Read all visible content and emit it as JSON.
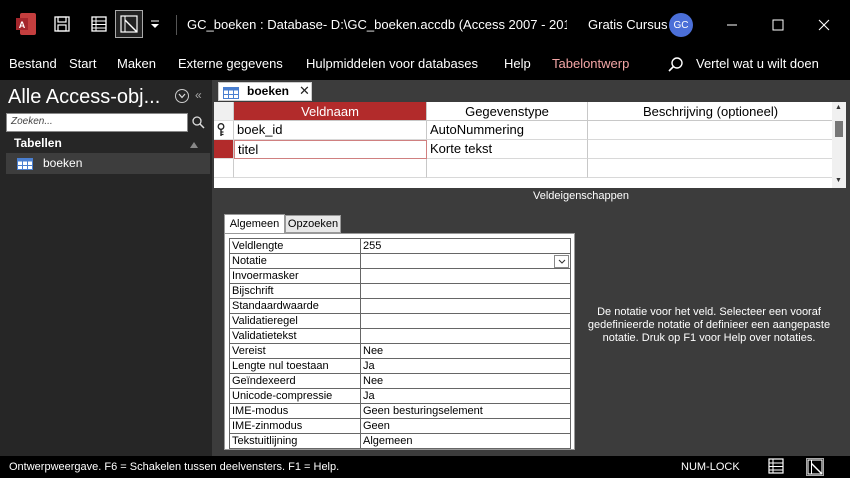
{
  "window": {
    "title": "GC_boeken : Database- D:\\GC_boeken.accdb (Access 2007 - 2016-bes...",
    "user_name": "Gratis Cursus",
    "user_initials": "GC"
  },
  "ribbon": {
    "tabs": [
      "Bestand",
      "Start",
      "Maken",
      "Externe gegevens",
      "Hulpmiddelen voor databases",
      "Help",
      "Tabelontwerp"
    ],
    "tell_me": "Vertel wat u wilt doen"
  },
  "nav": {
    "title": "Alle Access-obj...",
    "search_placeholder": "Zoeken...",
    "group": "Tabellen",
    "items": [
      {
        "label": "boeken"
      }
    ]
  },
  "document": {
    "tab_label": "boeken",
    "columns": [
      "Veldnaam",
      "Gegevenstype",
      "Beschrijving (optioneel)"
    ],
    "rows": [
      {
        "name": "boek_id",
        "type": "AutoNummering",
        "description": "",
        "primary_key": true
      },
      {
        "name": "titel",
        "type": "Korte tekst",
        "description": "",
        "primary_key": false
      }
    ],
    "field_properties_caption": "Veldeigenschappen"
  },
  "properties": {
    "tabs": [
      "Algemeen",
      "Opzoeken"
    ],
    "rows": [
      {
        "name": "Veldlengte",
        "value": "255"
      },
      {
        "name": "Notatie",
        "value": ""
      },
      {
        "name": "Invoermasker",
        "value": ""
      },
      {
        "name": "Bijschrift",
        "value": ""
      },
      {
        "name": "Standaardwaarde",
        "value": ""
      },
      {
        "name": "Validatieregel",
        "value": ""
      },
      {
        "name": "Validatietekst",
        "value": ""
      },
      {
        "name": "Vereist",
        "value": "Nee"
      },
      {
        "name": "Lengte nul toestaan",
        "value": "Ja"
      },
      {
        "name": "Geïndexeerd",
        "value": "Nee"
      },
      {
        "name": "Unicode-compressie",
        "value": "Ja"
      },
      {
        "name": "IME-modus",
        "value": "Geen besturingselement"
      },
      {
        "name": "IME-zinmodus",
        "value": "Geen"
      },
      {
        "name": "Tekstuitlijning",
        "value": "Algemeen"
      }
    ],
    "help": "De notatie voor het veld. Selecteer een vooraf gedefinieerde notatie of definieer een aangepaste notatie. Druk op F1 voor Help over notaties."
  },
  "status": {
    "text": "Ontwerpweergave. F6 = Schakelen tussen deelvensters. F1 = Help.",
    "numlock": "NUM-LOCK"
  },
  "colors": {
    "accent": "#b22b2b",
    "background": "#1f1f1f",
    "avatar": "#4b6fd8"
  }
}
